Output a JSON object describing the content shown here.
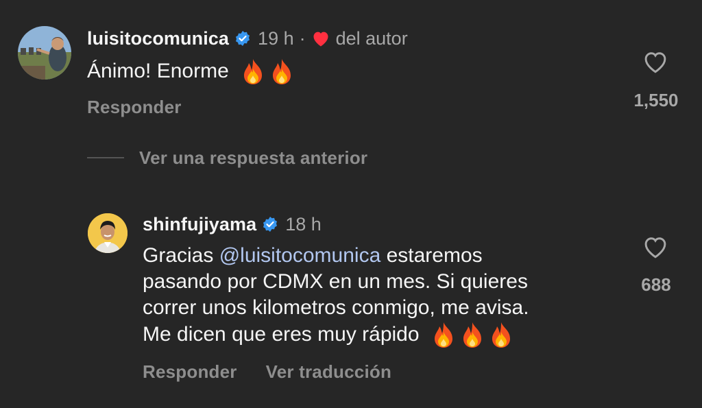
{
  "comments": [
    {
      "username": "luisitocomunica",
      "time": "19 h",
      "separator": "·",
      "author_like_label": "del autor",
      "text": "Ánimo! Enorme",
      "emojis": [
        "fire",
        "fire"
      ],
      "reply_label": "Responder",
      "like_count": "1,550"
    },
    {
      "username": "shinfujiyama",
      "time": "18 h",
      "text_lines": [
        {
          "prefix": "Gracias ",
          "mention": "@luisitocomunica",
          "suffix": " estaremos"
        },
        "pasando por CDMX en un mes. Si quieres",
        "correr unos kilometros conmigo, me avisa.",
        "Me dicen que eres muy rápido"
      ],
      "emojis": [
        "fire",
        "fire",
        "fire"
      ],
      "reply_label": "Responder",
      "translate_label": "Ver traducción",
      "like_count": "688"
    }
  ],
  "view_replies_label": "Ver una respuesta anterior",
  "colors": {
    "background": "#262626",
    "verified_badge": "#3897f0",
    "author_heart": "#ff3040",
    "mention": "#b2c7f0",
    "secondary_text": "#a8a8a8"
  }
}
